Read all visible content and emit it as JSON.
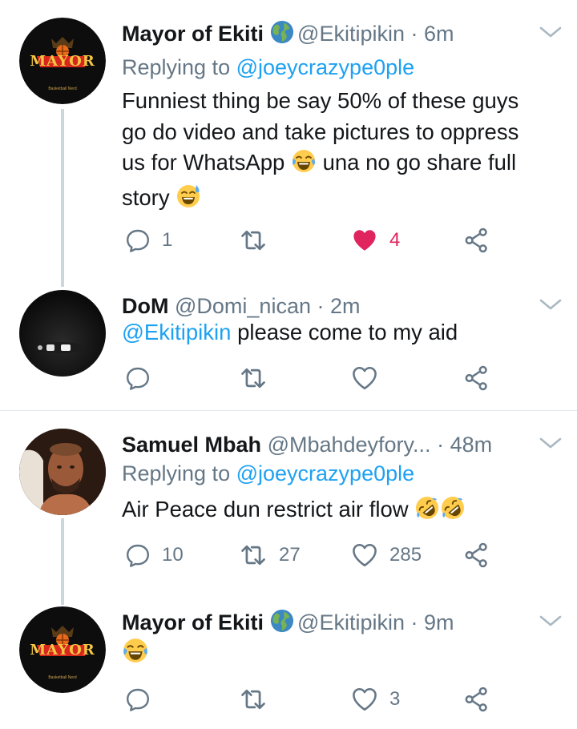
{
  "colors": {
    "link": "#1da1f2",
    "muted": "#657786",
    "like": "#e0245e",
    "divider": "#e1e8ed",
    "thread_line": "#ccd6dd"
  },
  "tweets": [
    {
      "name": "Mayor of Ekiti",
      "handle": "@Ekitipikin",
      "separator": "·",
      "time": "6m",
      "replying_prefix": "Replying to",
      "replying_to": "@joeycrazype0ple",
      "text_lines": [
        "Funniest thing be say 50% of these guys",
        "go do video and take pictures to oppress",
        "us for WhatsApp",
        "una no go share full",
        "story"
      ],
      "avatar_logo": "MAYOR",
      "avatar_sub": "Basketball Nerd",
      "reply_count": "1",
      "retweet_count": "",
      "like_count": "4",
      "liked": true
    },
    {
      "name": "DoM",
      "handle": "@Domi_nican",
      "separator": "·",
      "time": "2m",
      "mention": "@Ekitipikin",
      "text": "please come to my aid",
      "reply_count": "",
      "retweet_count": "",
      "like_count": ""
    },
    {
      "name": "Samuel Mbah",
      "handle": "@Mbahdeyfory...",
      "separator": "·",
      "time": "48m",
      "replying_prefix": "Replying to",
      "replying_to": "@joeycrazype0ple",
      "text": "Air Peace dun restrict air flow",
      "reply_count": "10",
      "retweet_count": "27",
      "like_count": "285"
    },
    {
      "name": "Mayor of Ekiti",
      "handle": "@Ekitipikin",
      "separator": "·",
      "time": "9m",
      "avatar_logo": "MAYOR",
      "avatar_sub": "Basketball Nerd",
      "reply_count": "",
      "retweet_count": "",
      "like_count": "3"
    }
  ]
}
